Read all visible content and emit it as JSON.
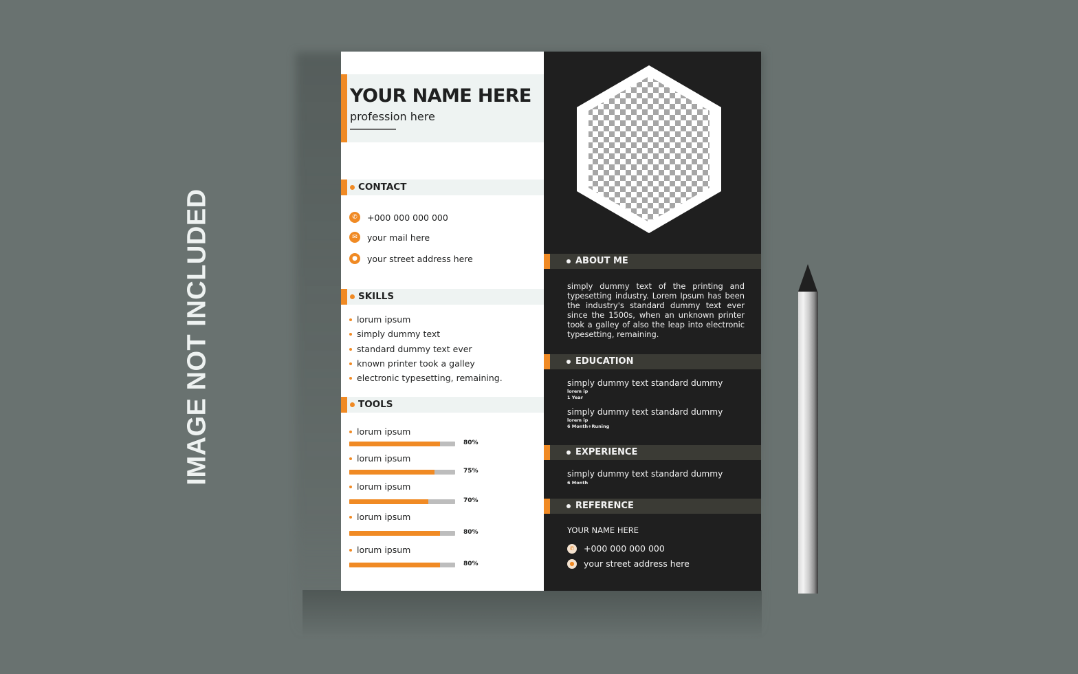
{
  "watermark": "IMAGE NOT INCLUDED",
  "resume": {
    "name": "YOUR NAME HERE",
    "profession": "profession here",
    "photo_placeholder": "transparent-checkerboard",
    "colors": {
      "accent": "#f08a24",
      "dark_panel": "#1f1f1f",
      "section_band_light": "#eef3f2",
      "section_band_dark": "#3b3b35",
      "background": "#697270"
    },
    "contact": {
      "title": "CONTACT",
      "items": [
        {
          "icon": "phone-icon",
          "text": "+000 000 000 000"
        },
        {
          "icon": "mail-icon",
          "text": "your mail here"
        },
        {
          "icon": "location-pin-icon",
          "text": "your street address here"
        }
      ]
    },
    "skills": {
      "title": "SKILLS",
      "items": [
        "lorum ipsum",
        "simply dummy text",
        "standard dummy text ever",
        "known printer took a galley",
        "electronic typesetting, remaining."
      ]
    },
    "tools": {
      "title": "TOOLS",
      "items": [
        {
          "label": "lorum ipsum",
          "percent": 80,
          "percent_label": "80%"
        },
        {
          "label": "lorum ipsum",
          "percent": 75,
          "percent_label": "75%"
        },
        {
          "label": "lorum ipsum",
          "percent": 70,
          "percent_label": "70%"
        },
        {
          "label": "lorum ipsum",
          "percent": 80,
          "percent_label": "80%"
        },
        {
          "label": "lorum ipsum",
          "percent": 80,
          "percent_label": "80%"
        }
      ]
    },
    "about": {
      "title": "ABOUT ME",
      "text": "simply dummy text of the printing and typesetting industry. Lorem Ipsum has been the industry's standard dummy text ever since the 1500s, when an unknown printer took a galley of  also the leap into electronic typesetting, remaining."
    },
    "education": {
      "title": "EDUCATION",
      "items": [
        {
          "title": "simply dummy text standard dummy",
          "subtitle": "lorem ip",
          "duration": "1 Year"
        },
        {
          "title": "simply dummy text standard dummy",
          "subtitle": "lorem ip",
          "duration": "6 Month+Runing"
        }
      ]
    },
    "experience": {
      "title": "EXPERIENCE",
      "items": [
        {
          "title": "simply dummy text standard dummy",
          "duration": "6 Month"
        }
      ]
    },
    "reference": {
      "title": "REFERENCE",
      "name": "YOUR NAME HERE",
      "phone": "+000 000 000 000",
      "address": "your street address here"
    }
  }
}
